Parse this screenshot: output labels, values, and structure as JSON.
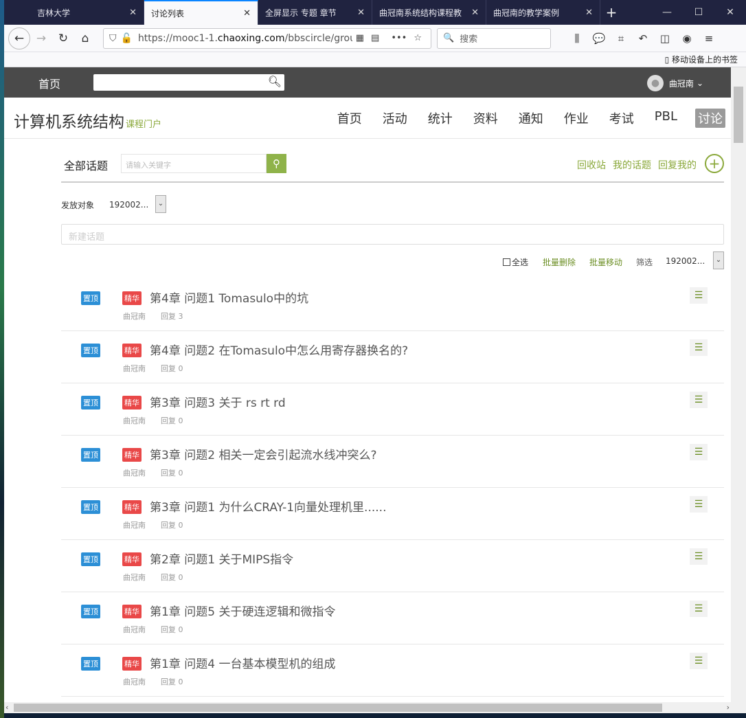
{
  "browser": {
    "tabs": [
      {
        "title": "吉林大学"
      },
      {
        "title": "讨论列表"
      },
      {
        "title": "全屏显示 专题 章节"
      },
      {
        "title": "曲冠南系统结构课程教"
      },
      {
        "title": "曲冠南的教学案例"
      }
    ],
    "url_prefix": "https://mooc1-1.",
    "url_domain": "chaoxing.com",
    "url_suffix": "/bbscircle/grou",
    "search_placeholder": "搜索",
    "bookmark_text": "移动设备上的书签"
  },
  "site": {
    "home": "首页",
    "user_name": "曲冠南",
    "course_title": "计算机系统结构",
    "course_portal": "课程门户",
    "nav": [
      "首页",
      "活动",
      "统计",
      "资料",
      "通知",
      "作业",
      "考试",
      "PBL",
      "讨论"
    ]
  },
  "discussion": {
    "section_title": "全部话题",
    "keyword_placeholder": "请输入关键字",
    "links": [
      "回收站",
      "我的话题",
      "回复我的"
    ],
    "target_label": "发放对象",
    "target_value": "192002...",
    "new_topic_placeholder": "新建话题",
    "select_all": "全选",
    "batch_delete": "批量删除",
    "batch_move": "批量移动",
    "filter_label": "筛选",
    "filter_value": "192002...",
    "pin_label": "置顶",
    "essence_label": "精华",
    "topics": [
      {
        "title": "第4章 问题1 Tomasulo中的坑",
        "author": "曲冠南",
        "replies": "回复 3"
      },
      {
        "title": "第4章 问题2 在Tomasulo中怎么用寄存器换名的?",
        "author": "曲冠南",
        "replies": "回复 0"
      },
      {
        "title": "第3章 问题3 关于 rs rt rd",
        "author": "曲冠南",
        "replies": "回复 0"
      },
      {
        "title": "第3章 问题2  相关一定会引起流水线冲突么?",
        "author": "曲冠南",
        "replies": "回复 0"
      },
      {
        "title": "第3章 问题1 为什么CRAY-1向量处理机里......",
        "author": "曲冠南",
        "replies": "回复 0"
      },
      {
        "title": "第2章 问题1 关于MIPS指令",
        "author": "曲冠南",
        "replies": "回复 0"
      },
      {
        "title": "第1章 问题5  关于硬连逻辑和微指令",
        "author": "曲冠南",
        "replies": "回复 0"
      },
      {
        "title": "第1章 问题4 一台基本模型机的组成",
        "author": "曲冠南",
        "replies": "回复 0"
      }
    ]
  },
  "colors": {
    "accent_green": "#8aa83a",
    "pin_blue": "#2c8fd6",
    "essence_red": "#e94848",
    "header_gray": "#4a4a4a"
  }
}
